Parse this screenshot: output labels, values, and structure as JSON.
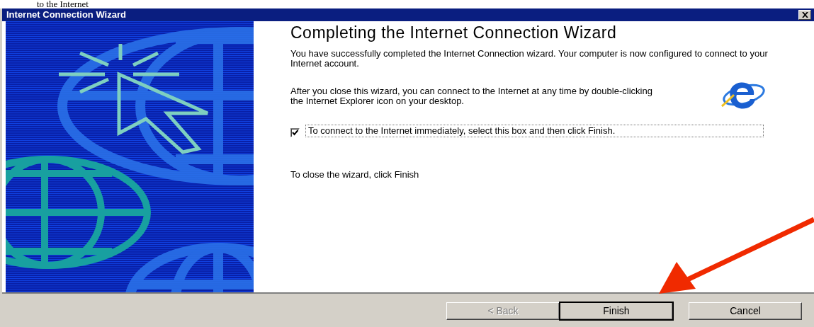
{
  "document_text": "to the Internet",
  "window": {
    "title": "Internet Connection Wizard"
  },
  "heading": "Completing the Internet Connection Wizard",
  "paragraphs": [
    "You have successfully completed the Internet Connection wizard. Your computer is now configured to connect to your Internet account.",
    "After you close this wizard, you can connect to the Internet at any time by double-clicking the Internet Explorer icon on your desktop."
  ],
  "checkbox": {
    "label": "To connect to the Internet immediately, select this box and then click Finish.",
    "checked": true
  },
  "closing_text": "To close the wizard, click Finish",
  "buttons": [
    {
      "label": "< Back",
      "disabled": true,
      "default": false
    },
    {
      "label": "Finish",
      "disabled": false,
      "default": true
    },
    {
      "label": "Cancel",
      "disabled": false,
      "default": false
    }
  ]
}
